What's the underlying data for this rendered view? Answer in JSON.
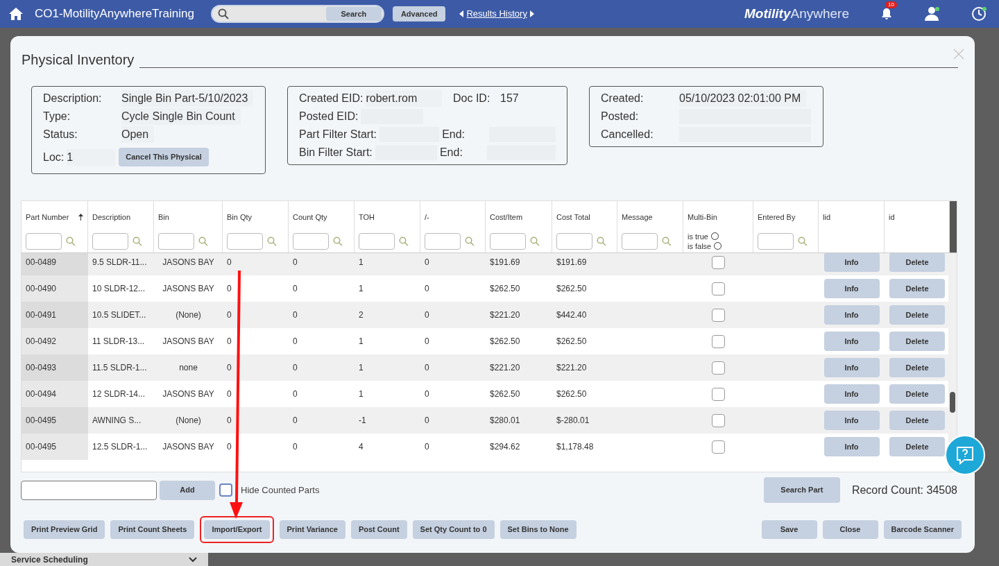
{
  "header": {
    "title": "CO1-MotilityAnywhereTraining",
    "search_button": "Search",
    "advanced_button": "Advanced",
    "history_link": "Results History",
    "logo_bold": "Motility",
    "logo_light": "Anywhere",
    "notification_count": "10"
  },
  "background": {
    "sidebar_item": "Service Scheduling"
  },
  "dialog": {
    "title": "Physical Inventory",
    "boxes": [
      {
        "fields": [
          {
            "label": "Description:",
            "value": "Single Bin Part-5/10/2023"
          },
          {
            "label": "Type:",
            "value": "Cycle Single Bin Count"
          },
          {
            "label": "Status:",
            "value": "Open"
          }
        ],
        "loc_label": "Loc:",
        "loc_value": "1",
        "button": "Cancel This Physical"
      },
      {
        "fields": [
          {
            "label": "Created EID:",
            "value": "robert.rom",
            "label2": "Doc ID:",
            "value2": "157"
          },
          {
            "label": "Posted EID:"
          },
          {
            "label": "Part Filter Start:",
            "label2": "End:"
          },
          {
            "label": "Bin Filter Start:",
            "label2": "End:"
          }
        ]
      },
      {
        "fields": [
          {
            "label": "Created:",
            "value": "05/10/2023 02:01:00 PM"
          },
          {
            "label": "Posted:"
          },
          {
            "label": "Cancelled:"
          }
        ]
      }
    ],
    "table": {
      "columns": [
        {
          "label": "Part Number",
          "sorted": true,
          "kind": "text"
        },
        {
          "label": "Description",
          "kind": "text"
        },
        {
          "label": "Bin",
          "kind": "text"
        },
        {
          "label": "Bin Qty",
          "kind": "text"
        },
        {
          "label": "Count Qty",
          "kind": "text"
        },
        {
          "label": "TOH",
          "kind": "text"
        },
        {
          "label": "/-",
          "kind": "text"
        },
        {
          "label": "Cost/Item",
          "kind": "text"
        },
        {
          "label": "Cost Total",
          "kind": "text"
        },
        {
          "label": "Message",
          "kind": "text"
        },
        {
          "label": "Multi-Bin",
          "kind": "bool",
          "true_label": "is true",
          "true_selected": false,
          "false_label": "is false",
          "false_selected": false
        },
        {
          "label": "Entered By",
          "kind": "text"
        },
        {
          "label": "lid",
          "kind": "plain"
        },
        {
          "label": "id",
          "kind": "plain"
        }
      ],
      "rows": [
        {
          "cells": [
            "00-0489",
            "9.5 SLDR-11...",
            "JASONS BAY",
            "0",
            "0",
            "1",
            "0",
            "$191.69",
            "$191.69"
          ],
          "multi_bin": false,
          "info": "Info",
          "delete": "Delete"
        },
        {
          "cells": [
            "00-0490",
            "10 SLDR-12...",
            "JASONS BAY",
            "0",
            "0",
            "1",
            "0",
            "$262.50",
            "$262.50"
          ],
          "multi_bin": false,
          "info": "Info",
          "delete": "Delete"
        },
        {
          "cells": [
            "00-0491",
            "10.5 SLIDET...",
            "(None)",
            "0",
            "0",
            "2",
            "0",
            "$221.20",
            "$442.40"
          ],
          "multi_bin": false,
          "info": "Info",
          "delete": "Delete"
        },
        {
          "cells": [
            "00-0492",
            "11 SLDR-13...",
            "JASONS BAY",
            "0",
            "0",
            "1",
            "0",
            "$262.50",
            "$262.50"
          ],
          "multi_bin": false,
          "info": "Info",
          "delete": "Delete"
        },
        {
          "cells": [
            "00-0493",
            "11.5 SLDR-1...",
            "none",
            "0",
            "0",
            "1",
            "0",
            "$221.20",
            "$221.20"
          ],
          "multi_bin": false,
          "info": "Info",
          "delete": "Delete"
        },
        {
          "cells": [
            "00-0494",
            "12 SLDR-14...",
            "JASONS BAY",
            "0",
            "0",
            "1",
            "0",
            "$262.50",
            "$262.50"
          ],
          "multi_bin": false,
          "info": "Info",
          "delete": "Delete"
        },
        {
          "cells": [
            "00-0495",
            "AWNING S...",
            "(None)",
            "0",
            "0",
            "-1",
            "0",
            "$280.01",
            "$-280.01"
          ],
          "multi_bin": false,
          "info": "Info",
          "delete": "Delete"
        },
        {
          "cells": [
            "00-0495",
            "12.5 SLDR-1...",
            "JASONS BAY",
            "0",
            "0",
            "4",
            "0",
            "$294.62",
            "$1,178.48"
          ],
          "multi_bin": false,
          "info": "Info",
          "delete": "Delete"
        }
      ]
    },
    "add_button": "Add",
    "hide_counted": {
      "label": "Hide Counted Parts",
      "checked": false
    },
    "search_part_button": "Search Part",
    "record_count": "Record Count: 34508",
    "buttons_left": [
      {
        "label": "Print Preview Grid",
        "highlighted": false
      },
      {
        "label": "Print Count Sheets",
        "highlighted": false
      },
      {
        "label": "Import/Export",
        "highlighted": true
      },
      {
        "label": "Print Variance",
        "highlighted": false
      },
      {
        "label": "Post Count",
        "highlighted": false
      },
      {
        "label": "Set Qty Count to 0",
        "highlighted": false
      },
      {
        "label": "Set Bins to None",
        "highlighted": false
      }
    ],
    "buttons_right": [
      {
        "label": "Save",
        "highlighted": false
      },
      {
        "label": "Close",
        "highlighted": false
      },
      {
        "label": "Barcode Scanner",
        "highlighted": false
      }
    ]
  }
}
